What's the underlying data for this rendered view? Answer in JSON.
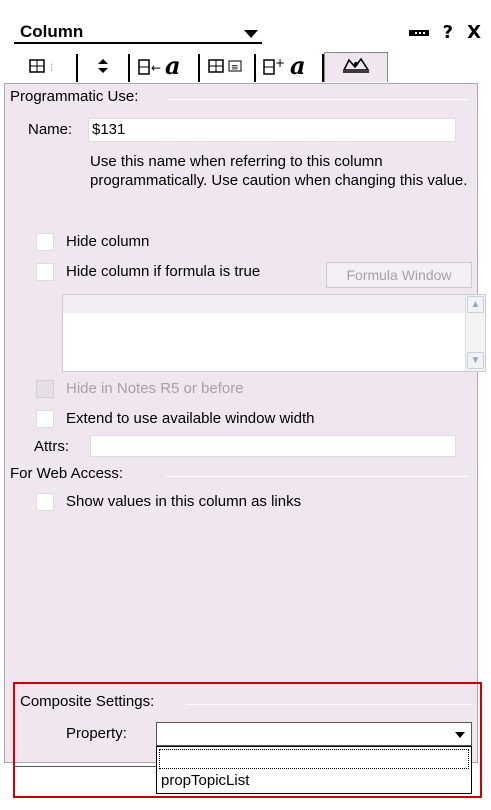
{
  "title_bar": {
    "dropdown_label": "Column",
    "help_glyph": "?",
    "close_glyph": "X"
  },
  "tabs": [
    {
      "icon": "column-info-icon",
      "glyph": "⊞ ⁞"
    },
    {
      "icon": "sort-icon",
      "glyph": "⬍"
    },
    {
      "icon": "column-font-icon",
      "glyph": "a"
    },
    {
      "icon": "column-number-icon",
      "glyph": "⊞ ≣"
    },
    {
      "icon": "column-title-font-icon",
      "glyph": "a"
    },
    {
      "icon": "advanced-hat-icon",
      "glyph": "⛬",
      "active": true
    }
  ],
  "programmatic_use": {
    "heading": "Programmatic Use:",
    "name_label": "Name:",
    "name_value": "$131",
    "description": "Use this name when referring to this column programmatically.  Use caution when changing this value."
  },
  "options": {
    "hide_column": "Hide column",
    "hide_if_formula": "Hide column if formula is true",
    "formula_window": "Formula Window",
    "hide_notes_r5": "Hide in Notes R5 or before",
    "extend_width": "Extend to use available window width",
    "attrs_label": "Attrs:",
    "attrs_value": ""
  },
  "web_access": {
    "heading": "For Web Access:",
    "show_links": "Show values in this column as links"
  },
  "composite": {
    "heading": "Composite Settings:",
    "property_label": "Property:",
    "property_value": "",
    "options": [
      "",
      "propTopicList"
    ]
  },
  "colors": {
    "panel_bg": "#efe6ef",
    "highlight": "#d40000"
  }
}
